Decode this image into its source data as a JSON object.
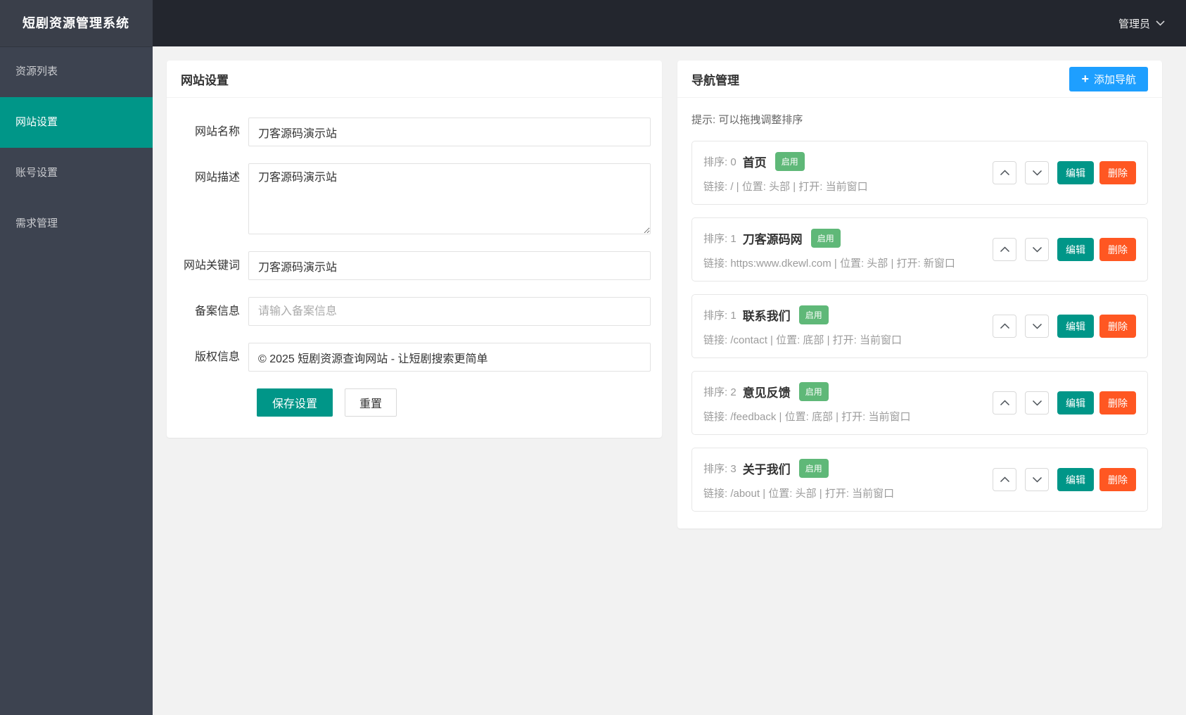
{
  "app": {
    "title": "短剧资源管理系统"
  },
  "topbar": {
    "user_label": "管理员"
  },
  "sidebar": {
    "items": [
      {
        "label": "资源列表"
      },
      {
        "label": "网站设置"
      },
      {
        "label": "账号设置"
      },
      {
        "label": "需求管理"
      }
    ]
  },
  "site_settings": {
    "title": "网站设置",
    "fields": {
      "name": {
        "label": "网站名称",
        "value": "刀客源码演示站"
      },
      "description": {
        "label": "网站描述",
        "value": "刀客源码演示站"
      },
      "keywords": {
        "label": "网站关键词",
        "value": "刀客源码演示站"
      },
      "icp": {
        "label": "备案信息",
        "value": "",
        "placeholder": "请输入备案信息"
      },
      "copyright": {
        "label": "版权信息",
        "value": "© 2025 短剧资源查询网站 - 让短剧搜索更简单"
      }
    },
    "save_label": "保存设置",
    "reset_label": "重置"
  },
  "nav_manage": {
    "title": "导航管理",
    "add_label": "添加导航",
    "hint": "提示: 可以拖拽调整排序",
    "edit_label": "编辑",
    "delete_label": "删除",
    "items": [
      {
        "sort_label": "排序: 0",
        "name": "首页",
        "status": "启用",
        "meta": "链接: / | 位置: 头部 | 打开: 当前窗口"
      },
      {
        "sort_label": "排序: 1",
        "name": "刀客源码网",
        "status": "启用",
        "meta": "链接: https:www.dkewl.com | 位置: 头部 | 打开: 新窗口"
      },
      {
        "sort_label": "排序: 1",
        "name": "联系我们",
        "status": "启用",
        "meta": "链接: /contact | 位置: 底部 | 打开: 当前窗口"
      },
      {
        "sort_label": "排序: 2",
        "name": "意见反馈",
        "status": "启用",
        "meta": "链接: /feedback | 位置: 底部 | 打开: 当前窗口"
      },
      {
        "sort_label": "排序: 3",
        "name": "关于我们",
        "status": "启用",
        "meta": "链接: /about | 位置: 头部 | 打开: 当前窗口"
      }
    ]
  },
  "colors": {
    "accent_teal": "#009688",
    "accent_blue": "#1e9fff",
    "status_green": "#5fb878",
    "danger_red": "#ff5722",
    "topbar_dark": "#23262e",
    "sidebar_dark": "#3d4350"
  }
}
